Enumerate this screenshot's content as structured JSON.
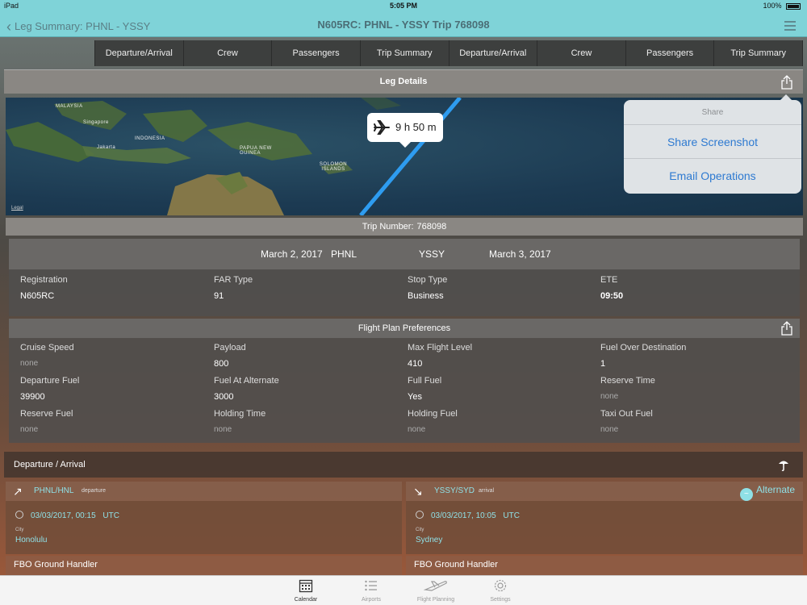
{
  "status_bar": {
    "carrier": "iPad",
    "time": "5:05 PM",
    "battery": "100%"
  },
  "nav": {
    "back_label": "Leg Summary: PHNL - YSSY",
    "title": "N605RC: PHNL - YSSY  Trip 768098"
  },
  "tabs": [
    "Departure/Arrival",
    "Crew",
    "Passengers",
    "Trip Summary",
    "Departure/Arrival",
    "Crew",
    "Passengers",
    "Trip Summary"
  ],
  "leg_details": {
    "title": "Leg Details"
  },
  "map": {
    "labels": [
      "MALAYSIA",
      "Singapore",
      "INDONESIA",
      "Jakarta",
      "PAPUA NEW GUINEA",
      "SOLOMON ISLANDS"
    ],
    "legal": "Legal",
    "flight_time": "9 h 50 m"
  },
  "share_popover": {
    "title": "Share",
    "items": [
      "Share Screenshot",
      "Email Operations"
    ]
  },
  "trip_number": {
    "label": "Trip Number:",
    "value": "768098"
  },
  "route": {
    "departure_date": "March 2, 2017",
    "origin": "PHNL",
    "destination": "YSSY",
    "arrival_date": "March 3, 2017",
    "fields": [
      {
        "label": "Registration",
        "value": "N605RC"
      },
      {
        "label": "FAR Type",
        "value": "91"
      },
      {
        "label": "Stop Type",
        "value": "Business"
      },
      {
        "label": "ETE",
        "value": "09:50"
      }
    ]
  },
  "flight_plan_prefs": {
    "title": "Flight Plan Preferences",
    "fields": [
      {
        "label": "Cruise Speed",
        "value": "none"
      },
      {
        "label": "Payload",
        "value": "800"
      },
      {
        "label": "Max Flight Level",
        "value": "410"
      },
      {
        "label": "Fuel Over Destination",
        "value": "1"
      },
      {
        "label": "Departure Fuel",
        "value": "39900"
      },
      {
        "label": "Fuel At Alternate",
        "value": "3000"
      },
      {
        "label": "Full Fuel",
        "value": "Yes"
      },
      {
        "label": "Reserve Time",
        "value": "none"
      },
      {
        "label": "Reserve Fuel",
        "value": "none"
      },
      {
        "label": "Holding Time",
        "value": "none"
      },
      {
        "label": "Holding Fuel",
        "value": "none"
      },
      {
        "label": "Taxi Out Fuel",
        "value": "none"
      }
    ]
  },
  "departure_arrival": {
    "title": "Departure / Arrival",
    "departure": {
      "code": "PHNL/HNL",
      "kind": "departure",
      "time": "03/03/2017, 00:15",
      "tz": "UTC",
      "city_label": "City",
      "city": "Honolulu"
    },
    "arrival": {
      "code": "YSSY/SYD",
      "kind": "arrival",
      "time": "03/03/2017, 10:05",
      "tz": "UTC",
      "city_label": "City",
      "city": "Sydney",
      "alternate_label": "Alternate"
    },
    "fbo_label": "FBO Ground Handler"
  },
  "bottom_tabs": [
    {
      "label": "Calendar",
      "icon": "calendar-icon",
      "active": true
    },
    {
      "label": "Airports",
      "icon": "list-icon",
      "active": false
    },
    {
      "label": "Flight Planning",
      "icon": "airplane-icon",
      "active": false
    },
    {
      "label": "Settings",
      "icon": "gear-icon",
      "active": false
    }
  ]
}
